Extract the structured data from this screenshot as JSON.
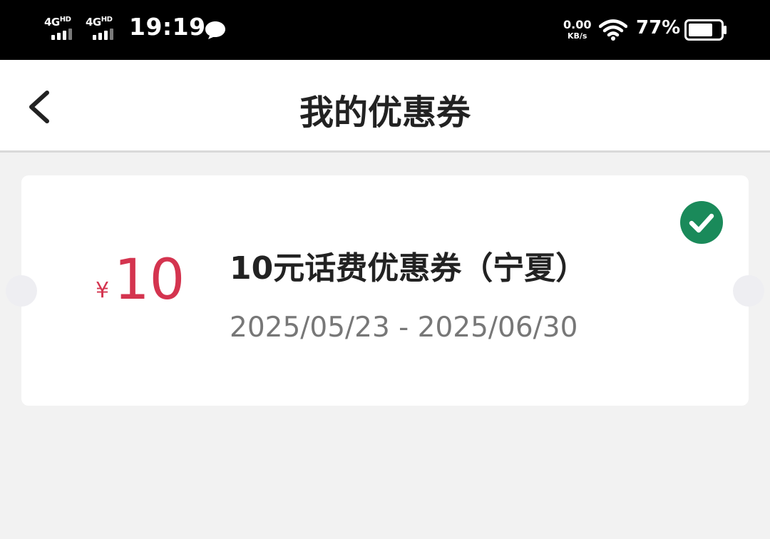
{
  "status_bar": {
    "sim1_network": "4G",
    "sim1_hd": "HD",
    "sim2_network": "4G",
    "sim2_hd": "HD",
    "time": "19:19",
    "net_speed_value": "0.00",
    "net_speed_unit": "KB/s",
    "battery_percent": "77%",
    "battery_level": 0.77,
    "icons": [
      "signal-icon",
      "chat-notification-icon",
      "wifi-icon",
      "battery-icon"
    ]
  },
  "header": {
    "title": "我的优惠券",
    "back_icon": "chevron-left-icon"
  },
  "coupon": {
    "currency_symbol": "¥",
    "amount": "10",
    "name": "10元话费优惠券（宁夏）",
    "date_range": "2025/05/23 - 2025/06/30",
    "selected": true,
    "check_icon": "check-circle-icon"
  },
  "colors": {
    "price": "#d4344f",
    "check": "#1a8a5a",
    "background": "#f2f2f2"
  }
}
